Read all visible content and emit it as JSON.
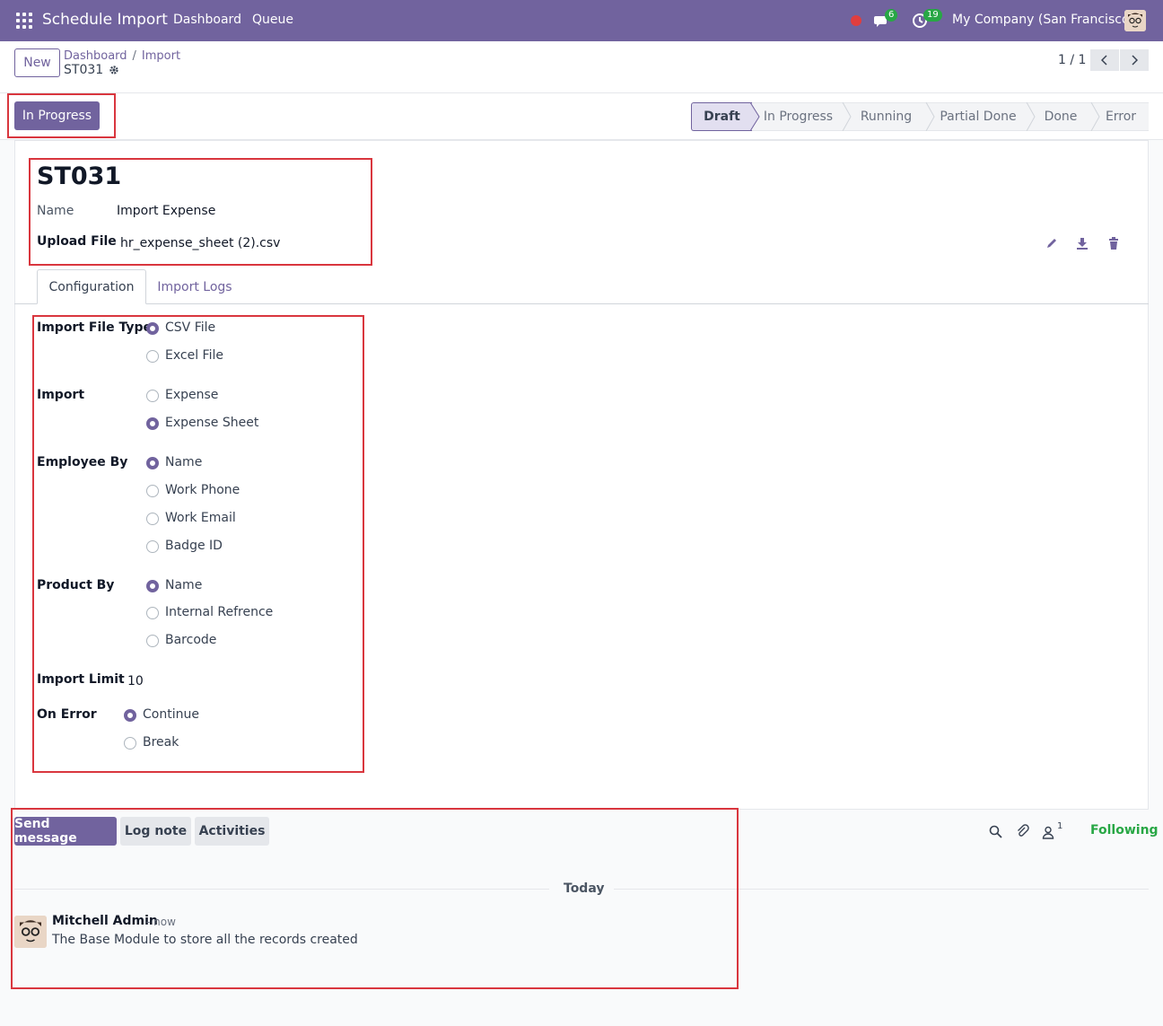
{
  "navbar": {
    "app_title": "Schedule Import",
    "menu": [
      "Dashboard",
      "Queue"
    ],
    "messages_count": "6",
    "activities_count": "19",
    "company": "My Company (San Francisco)"
  },
  "control": {
    "new_label": "New",
    "breadcrumbs": [
      "Dashboard",
      "Import"
    ],
    "record": "ST031",
    "pager": "1 / 1"
  },
  "statusbar": {
    "action_button": "In Progress",
    "stages": [
      "Draft",
      "In Progress",
      "Running",
      "Partial Done",
      "Done",
      "Error"
    ],
    "active_stage": "Draft"
  },
  "form": {
    "title": "ST031",
    "name_label": "Name",
    "name_value": "Import Expense",
    "upload_label": "Upload File",
    "upload_value": "hr_expense_sheet (2).csv",
    "tabs": [
      "Configuration",
      "Import Logs"
    ],
    "file_type": {
      "label": "Import File Type",
      "options": [
        "CSV File",
        "Excel File"
      ],
      "selected": "CSV File"
    },
    "import": {
      "label": "Import",
      "options": [
        "Expense",
        "Expense Sheet"
      ],
      "selected": "Expense Sheet"
    },
    "employee_by": {
      "label": "Employee By",
      "options": [
        "Name",
        "Work Phone",
        "Work Email",
        "Badge ID"
      ],
      "selected": "Name"
    },
    "product_by": {
      "label": "Product By",
      "options": [
        "Name",
        "Internal Refrence",
        "Barcode"
      ],
      "selected": "Name"
    },
    "import_limit": {
      "label": "Import Limit",
      "value": "10"
    },
    "on_error": {
      "label": "On Error",
      "options": [
        "Continue",
        "Break"
      ],
      "selected": "Continue"
    }
  },
  "chatter": {
    "send_message": "Send message",
    "log_note": "Log note",
    "activities": "Activities",
    "followers_count": "1",
    "following": "Following",
    "date_separator": "Today",
    "message": {
      "author": "Mitchell Admin",
      "time": "- now",
      "body": "The Base Module to store all the records created"
    }
  },
  "colors": {
    "brand": "#71639e",
    "annotation": "#d9363e",
    "following": "#28a745"
  }
}
